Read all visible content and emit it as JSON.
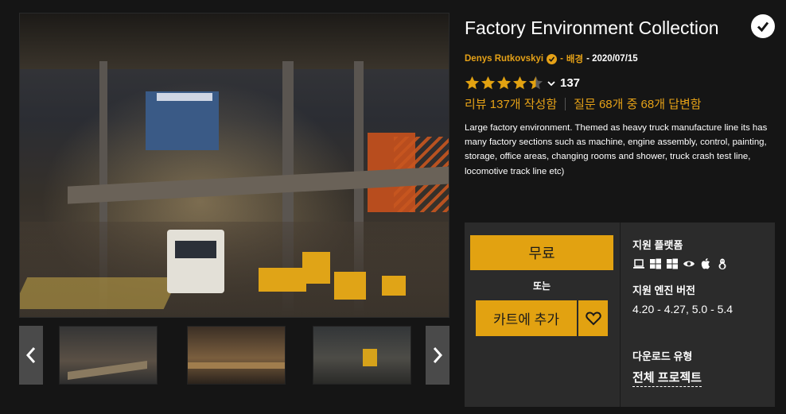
{
  "product": {
    "title": "Factory Environment Collection",
    "author": "Denys Rutkovskyi",
    "separator": "-",
    "category": "배경",
    "date_prefix": " - ",
    "date": "2020/07/15",
    "rating_count": "137",
    "rating_stars": 4.5,
    "reviews_text": "리뷰 137개 작성함",
    "questions_text": "질문 68개 중 68개 답변함",
    "description": "Large factory environment. Themed as heavy truck manufacture line its has many factory sections such as machine, engine assembly, control, painting, storage, office areas, changing rooms and shower, truck crash test line, locomotive track line etc)"
  },
  "purchase": {
    "free_label": "무료",
    "or_label": "또는",
    "cart_label": "카트에 추가"
  },
  "specs": {
    "platform_title": "지원 플랫폼",
    "platforms": [
      "laptop-icon",
      "windows-icon",
      "windows-icon",
      "eye-icon",
      "apple-icon",
      "linux-icon"
    ],
    "engine_title": "지원 엔진 버전",
    "engine_versions": "4.20 - 4.27, 5.0 - 5.4",
    "download_title": "다운로드 유형",
    "download_type": "전체 프로젝트"
  },
  "gallery": {
    "prev": "‹",
    "next": "›",
    "thumbnail_count": 3
  },
  "colors": {
    "accent": "#e2a211",
    "background": "#151515",
    "panel": "#2b2b2b"
  }
}
